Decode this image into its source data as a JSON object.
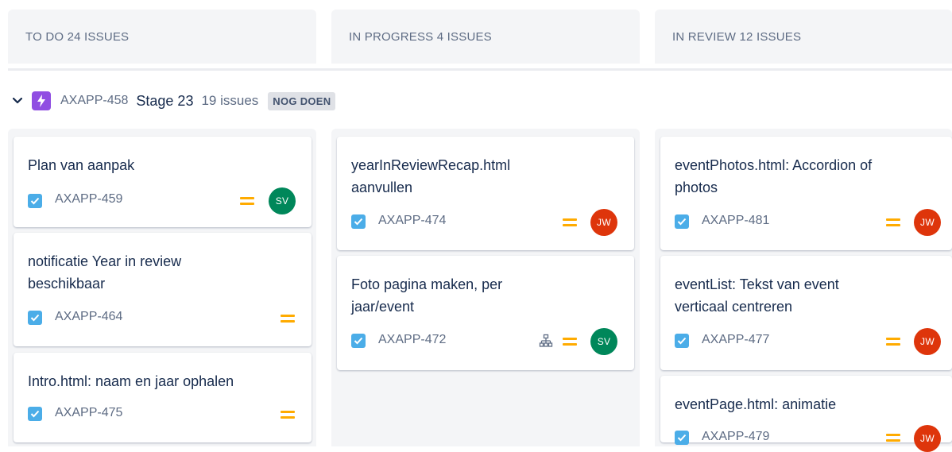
{
  "columns": [
    {
      "header": "TO DO 24 ISSUES"
    },
    {
      "header": "IN PROGRESS 4 ISSUES"
    },
    {
      "header": "IN REVIEW 12 ISSUES"
    }
  ],
  "swimlane": {
    "epic_key": "AXAPP-458",
    "name": "Stage 23",
    "count": "19 issues",
    "status": "NOG DOEN",
    "epic_color": "#904ee2"
  },
  "colors": {
    "task_icon": "#4bade8",
    "priority_medium": "#ffab00",
    "avatar_sv": "#00875a",
    "avatar_jw": "#de350b"
  },
  "cards": {
    "todo": [
      {
        "title": "Plan van aanpak",
        "key": "AXAPP-459",
        "priority": "medium",
        "avatar": "SV"
      },
      {
        "title": "notificatie Year in review beschikbaar",
        "key": "AXAPP-464",
        "priority": "medium",
        "avatar": ""
      },
      {
        "title": "Intro.html: naam en jaar ophalen",
        "key": "AXAPP-475",
        "priority": "medium",
        "avatar": ""
      }
    ],
    "in_progress": [
      {
        "title": "yearInReviewRecap.html aanvullen",
        "key": "AXAPP-474",
        "priority": "medium",
        "avatar": "JW"
      },
      {
        "title": "Foto pagina maken, per jaar/event",
        "key": "AXAPP-472",
        "priority": "medium",
        "avatar": "SV",
        "subtasks_icon": "subtask-icon"
      }
    ],
    "in_review": [
      {
        "title": "eventPhotos.html: Accordion of photos",
        "key": "AXAPP-481",
        "priority": "medium",
        "avatar": "JW"
      },
      {
        "title": "eventList: Tekst van event verticaal centreren",
        "key": "AXAPP-477",
        "priority": "medium",
        "avatar": "JW"
      },
      {
        "title": "eventPage.html: animatie",
        "key": "AXAPP-479",
        "priority": "medium",
        "avatar": "JW"
      }
    ]
  }
}
